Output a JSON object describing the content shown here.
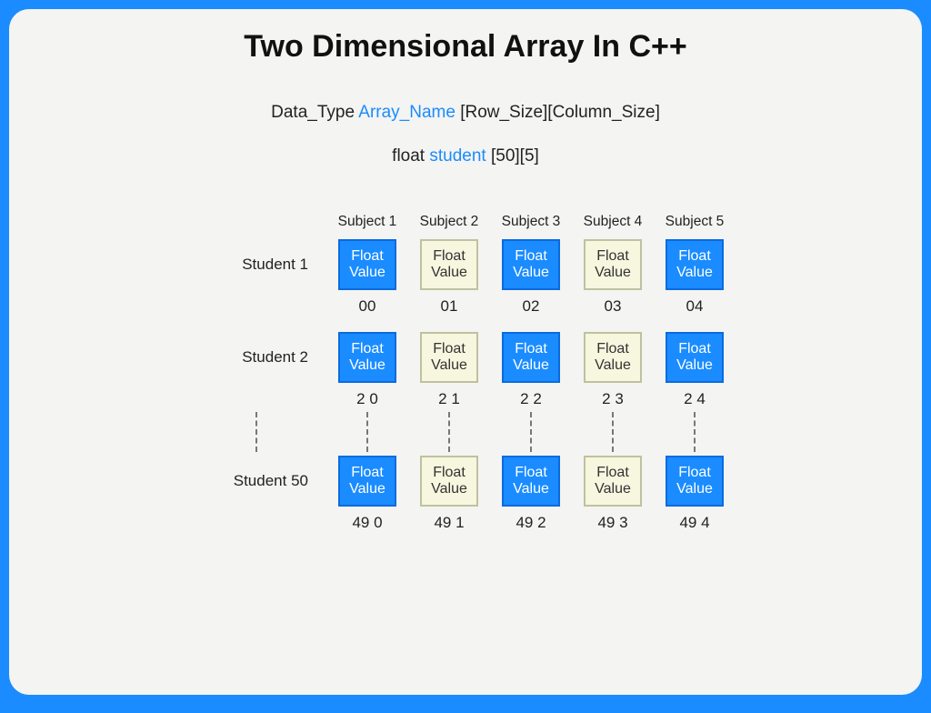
{
  "title": "Two Dimensional Array In C++",
  "syntax": {
    "prefix": "Data_Type ",
    "name": "Array_Name",
    "suffix": " [Row_Size][Column_Size]"
  },
  "example": {
    "prefix": "float ",
    "name": "student",
    "suffix": " [50][5]"
  },
  "subjects": [
    "Subject 1",
    "Subject 2",
    "Subject 3",
    "Subject 4",
    "Subject 5"
  ],
  "cell_label_top": "Float",
  "cell_label_bottom": "Value",
  "rows": [
    {
      "label": "Student 1",
      "indices": [
        "00",
        "01",
        "02",
        "03",
        "04"
      ]
    },
    {
      "label": "Student 2",
      "indices": [
        "2 0",
        "2 1",
        "2 2",
        "2 3",
        "2 4"
      ]
    },
    {
      "label": "Student 50",
      "indices": [
        "49 0",
        "49 1",
        "49 2",
        "49 3",
        "49 4"
      ]
    }
  ]
}
